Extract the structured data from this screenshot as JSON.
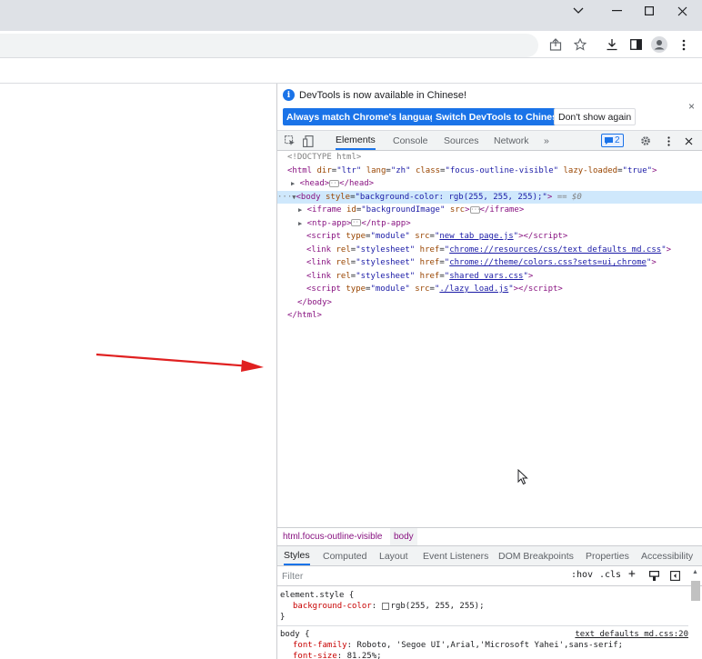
{
  "window": {
    "controls": [
      "chevron-down",
      "minimize",
      "maximize",
      "close"
    ]
  },
  "toolbar": {
    "icons": [
      "share-icon",
      "star-icon",
      "download-icon",
      "side-panel-icon",
      "profile-icon",
      "menu-icon"
    ]
  },
  "devtools": {
    "infobar": {
      "message": "DevTools is now available in Chinese!",
      "buttons": [
        "Always match Chrome's language",
        "Switch DevTools to Chinese",
        "Don't show again"
      ],
      "close": "×"
    },
    "tabs": [
      "Elements",
      "Console",
      "Sources",
      "Network"
    ],
    "more_tabs": "»",
    "issues_count": "2",
    "elements": {
      "doctype": "<!DOCTYPE html>",
      "html_open_tag": "<html",
      "html_attrs": [
        {
          "name": "dir",
          "value": "\"ltr\""
        },
        {
          "name": "lang",
          "value": "\"zh\""
        },
        {
          "name": "class",
          "value": "\"focus-outline-visible\""
        },
        {
          "name": "lazy-loaded",
          "value": "\"true\""
        }
      ],
      "head": "<head>",
      "head_close": "</head>",
      "body_dots": "···",
      "body_open": "<body",
      "body_attr": "style",
      "body_val": "\"background-color: rgb(255, 255, 255);\"",
      "body_sel": "== $0",
      "iframe_open": "<iframe",
      "iframe_attr": "id",
      "iframe_val": "\"backgroundImage\"",
      "iframe_src": "src",
      "iframe_close": "</iframe>",
      "ntp_open": "<ntp-app>",
      "ntp_close": "</ntp-app>",
      "script1_src": "new_tab_page.js",
      "link1_href": "chrome://resources/css/text_defaults_md.css",
      "link2_href": "chrome://theme/colors.css?sets=ui,chrome",
      "link3_href": "shared_vars.css",
      "script2_src": "./lazy_load.js",
      "body_close": "</body>",
      "html_close": "</html>"
    },
    "breadcrumbs": [
      "html.focus-outline-visible",
      "body"
    ],
    "style_tabs": [
      "Styles",
      "Computed",
      "Layout",
      "Event Listeners",
      "DOM Breakpoints",
      "Properties",
      "Accessibility"
    ],
    "filter": {
      "placeholder": "Filter",
      "hov": ":hov",
      "cls": ".cls",
      "plus": "+"
    },
    "rules": {
      "element_style": "element.style {",
      "bg_prop": "background-color",
      "bg_val": "rgb(255, 255, 255);",
      "close_brace": "}",
      "body_sel": "body {",
      "body_src": "text_defaults_md.css:20",
      "ff_prop": "font-family",
      "ff_val": "Roboto, 'Segoe UI',Arial,'Microsoft Yahei',sans-serif;",
      "fs_prop": "font-size",
      "fs_val": "81.25%;"
    }
  },
  "colors": {
    "accent": "#1a73e8",
    "tag": "#881280",
    "attr": "#994500",
    "value": "#1a1aa6",
    "arrow": "#e02020"
  }
}
